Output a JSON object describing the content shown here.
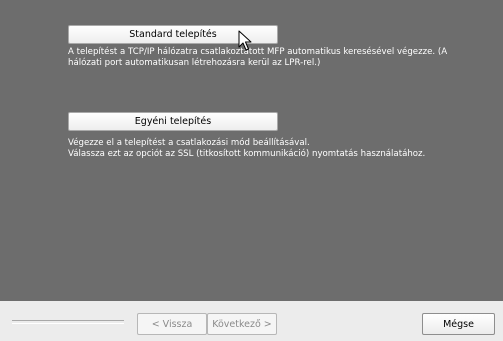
{
  "options": [
    {
      "label": "Standard telepítés",
      "description_lines": [
        "A telepítést a TCP/IP hálózatra csatlakoztatott MFP automatikus keresésével végezze. (A",
        "hálózati port automatikusan létrehozásra kerül az LPR-rel.)"
      ]
    },
    {
      "label": "Egyéni telepítés",
      "description_lines": [
        "Végezze el a telepítést a csatlakozási mód beállításával.",
        "Válassza ezt az opciót az SSL (titkosított kommunikáció) nyomtatás használatához."
      ]
    }
  ],
  "footer": {
    "back_label": "< Vissza",
    "next_label": "Következő >",
    "cancel_label": "Mégse"
  },
  "colors": {
    "panel_background": "#6d6d6d",
    "description_text": "#ffffff",
    "footer_background": "#ececec"
  },
  "icons": {
    "pointer": "mouse-pointer-icon"
  }
}
